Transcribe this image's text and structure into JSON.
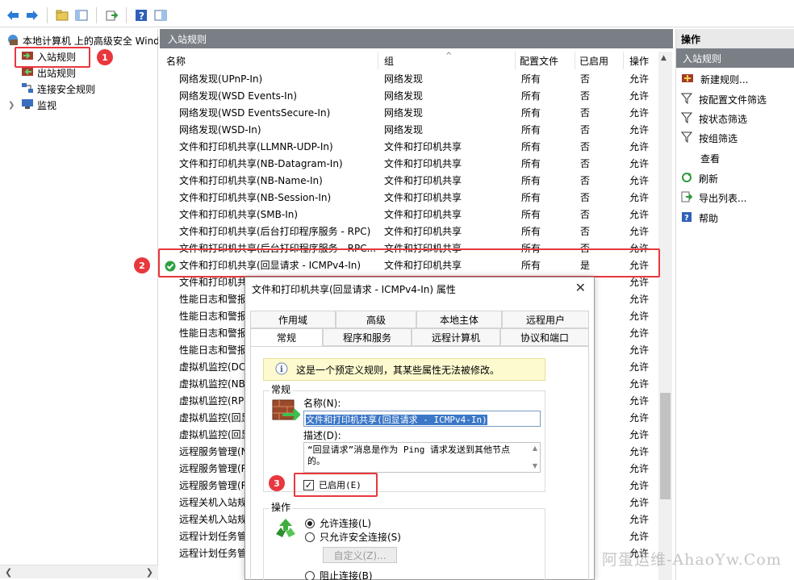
{
  "tree": {
    "root_label": "本地计算机 上的高级安全 Windows 防火墙",
    "items": [
      {
        "label": "入站规则"
      },
      {
        "label": "出站规则"
      },
      {
        "label": "连接安全规则"
      },
      {
        "label": "监视"
      }
    ]
  },
  "center": {
    "title": "入站规则",
    "columns": {
      "name": "名称",
      "group": "组",
      "profile": "配置文件",
      "enabled": "已启用",
      "action": "操作"
    },
    "rows": [
      {
        "name": "网络发现(UPnP-In)",
        "group": "网络发现",
        "profile": "所有",
        "enabled": "否",
        "action": "允许"
      },
      {
        "name": "网络发现(WSD Events-In)",
        "group": "网络发现",
        "profile": "所有",
        "enabled": "否",
        "action": "允许"
      },
      {
        "name": "网络发现(WSD EventsSecure-In)",
        "group": "网络发现",
        "profile": "所有",
        "enabled": "否",
        "action": "允许"
      },
      {
        "name": "网络发现(WSD-In)",
        "group": "网络发现",
        "profile": "所有",
        "enabled": "否",
        "action": "允许"
      },
      {
        "name": "文件和打印机共享(LLMNR-UDP-In)",
        "group": "文件和打印机共享",
        "profile": "所有",
        "enabled": "否",
        "action": "允许"
      },
      {
        "name": "文件和打印机共享(NB-Datagram-In)",
        "group": "文件和打印机共享",
        "profile": "所有",
        "enabled": "否",
        "action": "允许"
      },
      {
        "name": "文件和打印机共享(NB-Name-In)",
        "group": "文件和打印机共享",
        "profile": "所有",
        "enabled": "否",
        "action": "允许"
      },
      {
        "name": "文件和打印机共享(NB-Session-In)",
        "group": "文件和打印机共享",
        "profile": "所有",
        "enabled": "否",
        "action": "允许"
      },
      {
        "name": "文件和打印机共享(SMB-In)",
        "group": "文件和打印机共享",
        "profile": "所有",
        "enabled": "否",
        "action": "允许"
      },
      {
        "name": "文件和打印机共享(后台打印程序服务 - RPC)",
        "group": "文件和打印机共享",
        "profile": "所有",
        "enabled": "否",
        "action": "允许"
      },
      {
        "name": "文件和打印机共享(后台打印程序服务 - RPC...",
        "group": "文件和打印机共享",
        "profile": "所有",
        "enabled": "否",
        "action": "允许"
      },
      {
        "name": "文件和打印机共享(回显请求 - ICMPv4-In)",
        "group": "文件和打印机共享",
        "profile": "所有",
        "enabled": "是",
        "action": "允许"
      },
      {
        "name": "文件和打印机共享",
        "group": "",
        "profile": "",
        "enabled": "",
        "action": "允许"
      },
      {
        "name": "性能日志和警报",
        "group": "",
        "profile": "",
        "enabled": "",
        "action": "允许"
      },
      {
        "name": "性能日志和警报",
        "group": "",
        "profile": "",
        "enabled": "",
        "action": "允许"
      },
      {
        "name": "性能日志和警报",
        "group": "",
        "profile": "",
        "enabled": "",
        "action": "允许"
      },
      {
        "name": "性能日志和警报",
        "group": "",
        "profile": "",
        "enabled": "",
        "action": "允许"
      },
      {
        "name": "虚拟机监控(DC",
        "group": "",
        "profile": "",
        "enabled": "",
        "action": "允许"
      },
      {
        "name": "虚拟机监控(NB",
        "group": "",
        "profile": "",
        "enabled": "",
        "action": "允许"
      },
      {
        "name": "虚拟机监控(RP",
        "group": "",
        "profile": "",
        "enabled": "",
        "action": "允许"
      },
      {
        "name": "虚拟机监控(回显",
        "group": "",
        "profile": "",
        "enabled": "",
        "action": "允许"
      },
      {
        "name": "虚拟机监控(回显",
        "group": "",
        "profile": "",
        "enabled": "",
        "action": "允许"
      },
      {
        "name": "远程服务管理(N",
        "group": "",
        "profile": "",
        "enabled": "",
        "action": "允许"
      },
      {
        "name": "远程服务管理(R",
        "group": "",
        "profile": "",
        "enabled": "",
        "action": "允许"
      },
      {
        "name": "远程服务管理(R",
        "group": "",
        "profile": "",
        "enabled": "",
        "action": "允许"
      },
      {
        "name": "远程关机入站规",
        "group": "",
        "profile": "",
        "enabled": "",
        "action": "允许"
      },
      {
        "name": "远程关机入站规",
        "group": "",
        "profile": "",
        "enabled": "",
        "action": "允许"
      },
      {
        "name": "远程计划任务管",
        "group": "",
        "profile": "",
        "enabled": "",
        "action": "允许"
      },
      {
        "name": "远程计划任务管",
        "group": "",
        "profile": "",
        "enabled": "",
        "action": "允许"
      }
    ]
  },
  "actions": {
    "title": "操作",
    "subtitle": "入站规则",
    "items": [
      {
        "label": "新建规则..."
      },
      {
        "label": "按配置文件筛选"
      },
      {
        "label": "按状态筛选"
      },
      {
        "label": "按组筛选"
      },
      {
        "label": "查看"
      },
      {
        "label": "刷新"
      },
      {
        "label": "导出列表..."
      },
      {
        "label": "帮助"
      }
    ]
  },
  "dialog": {
    "title": "文件和打印机共享(回显请求 - ICMPv4-In) 属性",
    "tabs_row1": [
      "作用域",
      "高级",
      "本地主体",
      "远程用户"
    ],
    "tabs_row2": [
      "常规",
      "程序和服务",
      "远程计算机",
      "协议和端口"
    ],
    "info": "这是一个预定义规则，其某些属性无法被修改。",
    "general_label": "常规",
    "name_label": "名称(N):",
    "name_value": "文件和打印机共享(回显请求 - ICMPv4-In)",
    "desc_label": "描述(D):",
    "desc_value": "“回显请求”消息是作为 Ping 请求发送到其他节点的。",
    "enabled_label": "已启用(E)",
    "action_label": "操作",
    "radio_allow": "允许连接(L)",
    "radio_secure": "只允许安全连接(S)",
    "customize_button": "自定义(Z)...",
    "radio_block": "阻止连接(B)"
  },
  "badges": [
    "1",
    "2",
    "3"
  ],
  "watermark": "阿蛋运维-AhaoYw.Com",
  "colors": {
    "highlight_red": "#e8373d",
    "pane_header": "#7a7f86",
    "info_bg": "#fdfacf"
  }
}
